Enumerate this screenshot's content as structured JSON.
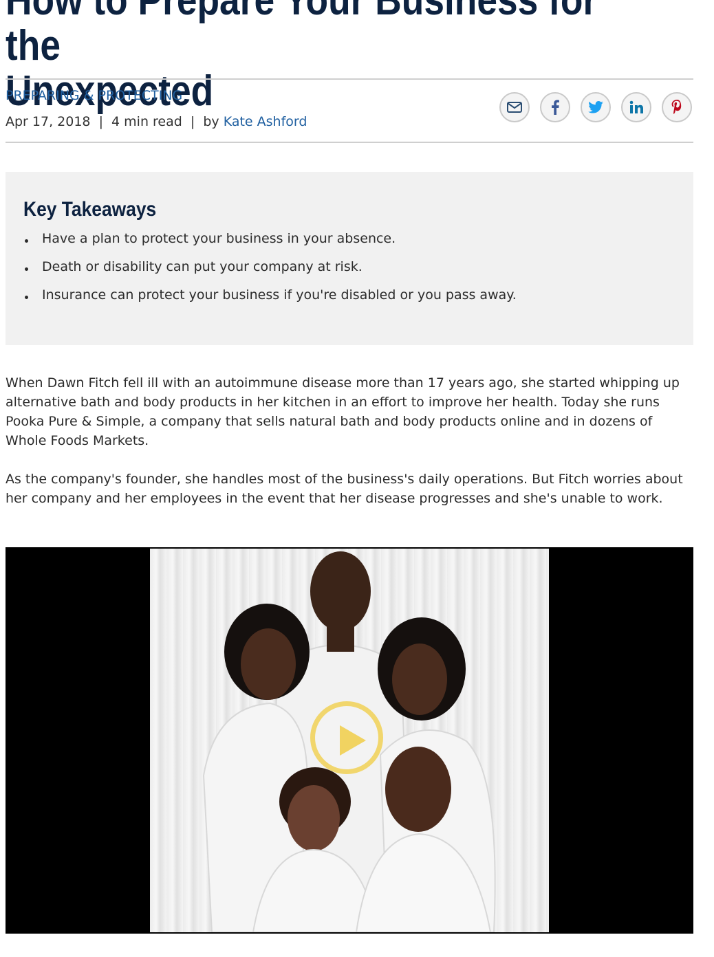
{
  "article": {
    "title": "How to Prepare Your Business for the\nUnexpected",
    "category": "PREPARING & PROTECTING",
    "date": "Apr 17, 2018",
    "read_time": "4 min read",
    "by_label": "by",
    "author": "Kate Ashford",
    "separator": "|"
  },
  "share": {
    "icons": [
      "email-icon",
      "facebook-icon",
      "twitter-icon",
      "linkedin-icon",
      "pinterest-icon"
    ],
    "colors": {
      "email": "#2a4d72",
      "facebook": "#3b5998",
      "twitter": "#1da1f2",
      "linkedin": "#0e76a8",
      "pinterest": "#bd081c"
    }
  },
  "takeaways": {
    "heading": "Key Takeaways",
    "items": [
      "Have a plan to protect your business in your absence.",
      "Death or disability can put your company at risk.",
      "Insurance can protect your business if you're disabled or you pass away."
    ]
  },
  "body": {
    "paragraphs": [
      "When Dawn Fitch fell ill with an autoimmune disease more than 17 years ago, she started whipping up alternative bath and body products in her kitchen in an effort to improve her health. Today she runs Pooka Pure & Simple, a company that sells natural bath and body products online and in dozens of Whole Foods Markets.",
      "As the company's founder, she handles most of the business's daily operations. But Fitch worries about her company and her employees in the event that her disease progresses and she's unable to work."
    ]
  },
  "video": {
    "play_icon": "play-icon",
    "play_color": "#f0cd46"
  },
  "theme": {
    "title_color": "#0d2240",
    "link_color": "#1f5fa0",
    "panel_bg": "#f1f1f1"
  }
}
